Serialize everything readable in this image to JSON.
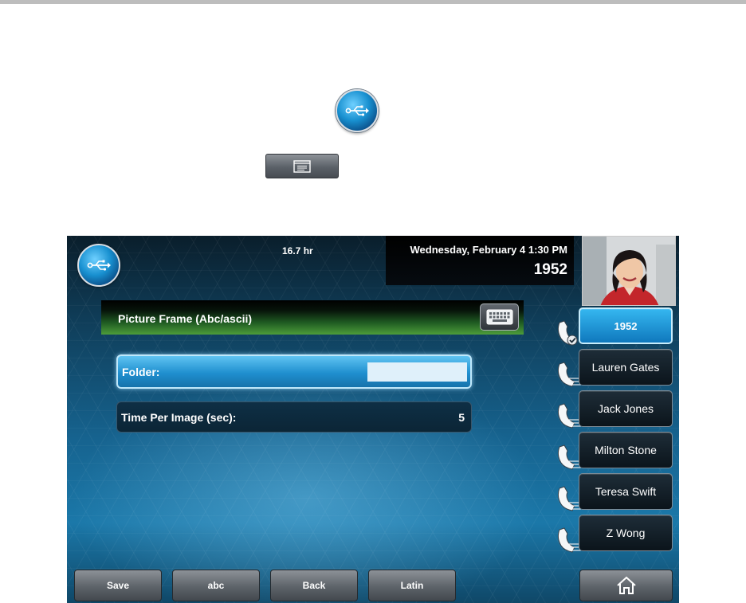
{
  "status": {
    "timer": "16.7 hr",
    "datetime": "Wednesday, February 4  1:30 PM",
    "line_number": "1952"
  },
  "screen": {
    "title": "Picture Frame (Abc/ascii)",
    "fields": {
      "folder": {
        "label": "Folder:",
        "value": ""
      },
      "time_per_image": {
        "label": "Time Per Image (sec):",
        "value": "5"
      }
    }
  },
  "line_keys": [
    {
      "label": "1952",
      "active": true
    },
    {
      "label": "Lauren Gates"
    },
    {
      "label": "Jack Jones"
    },
    {
      "label": "Milton Stone"
    },
    {
      "label": "Teresa Swift"
    },
    {
      "label": "Z Wong"
    }
  ],
  "soft_keys": {
    "save": "Save",
    "abc": "abc",
    "back": "Back",
    "latin": "Latin"
  },
  "icons": {
    "usb": "usb-icon",
    "keyboard": "keyboard-icon",
    "menu": "menu-icon",
    "home": "home-icon",
    "handset": "handset-icon",
    "registered_check": "check-icon"
  },
  "colors": {
    "accent_blue": "#1f8fcf",
    "title_green": "#4d9c3a"
  }
}
